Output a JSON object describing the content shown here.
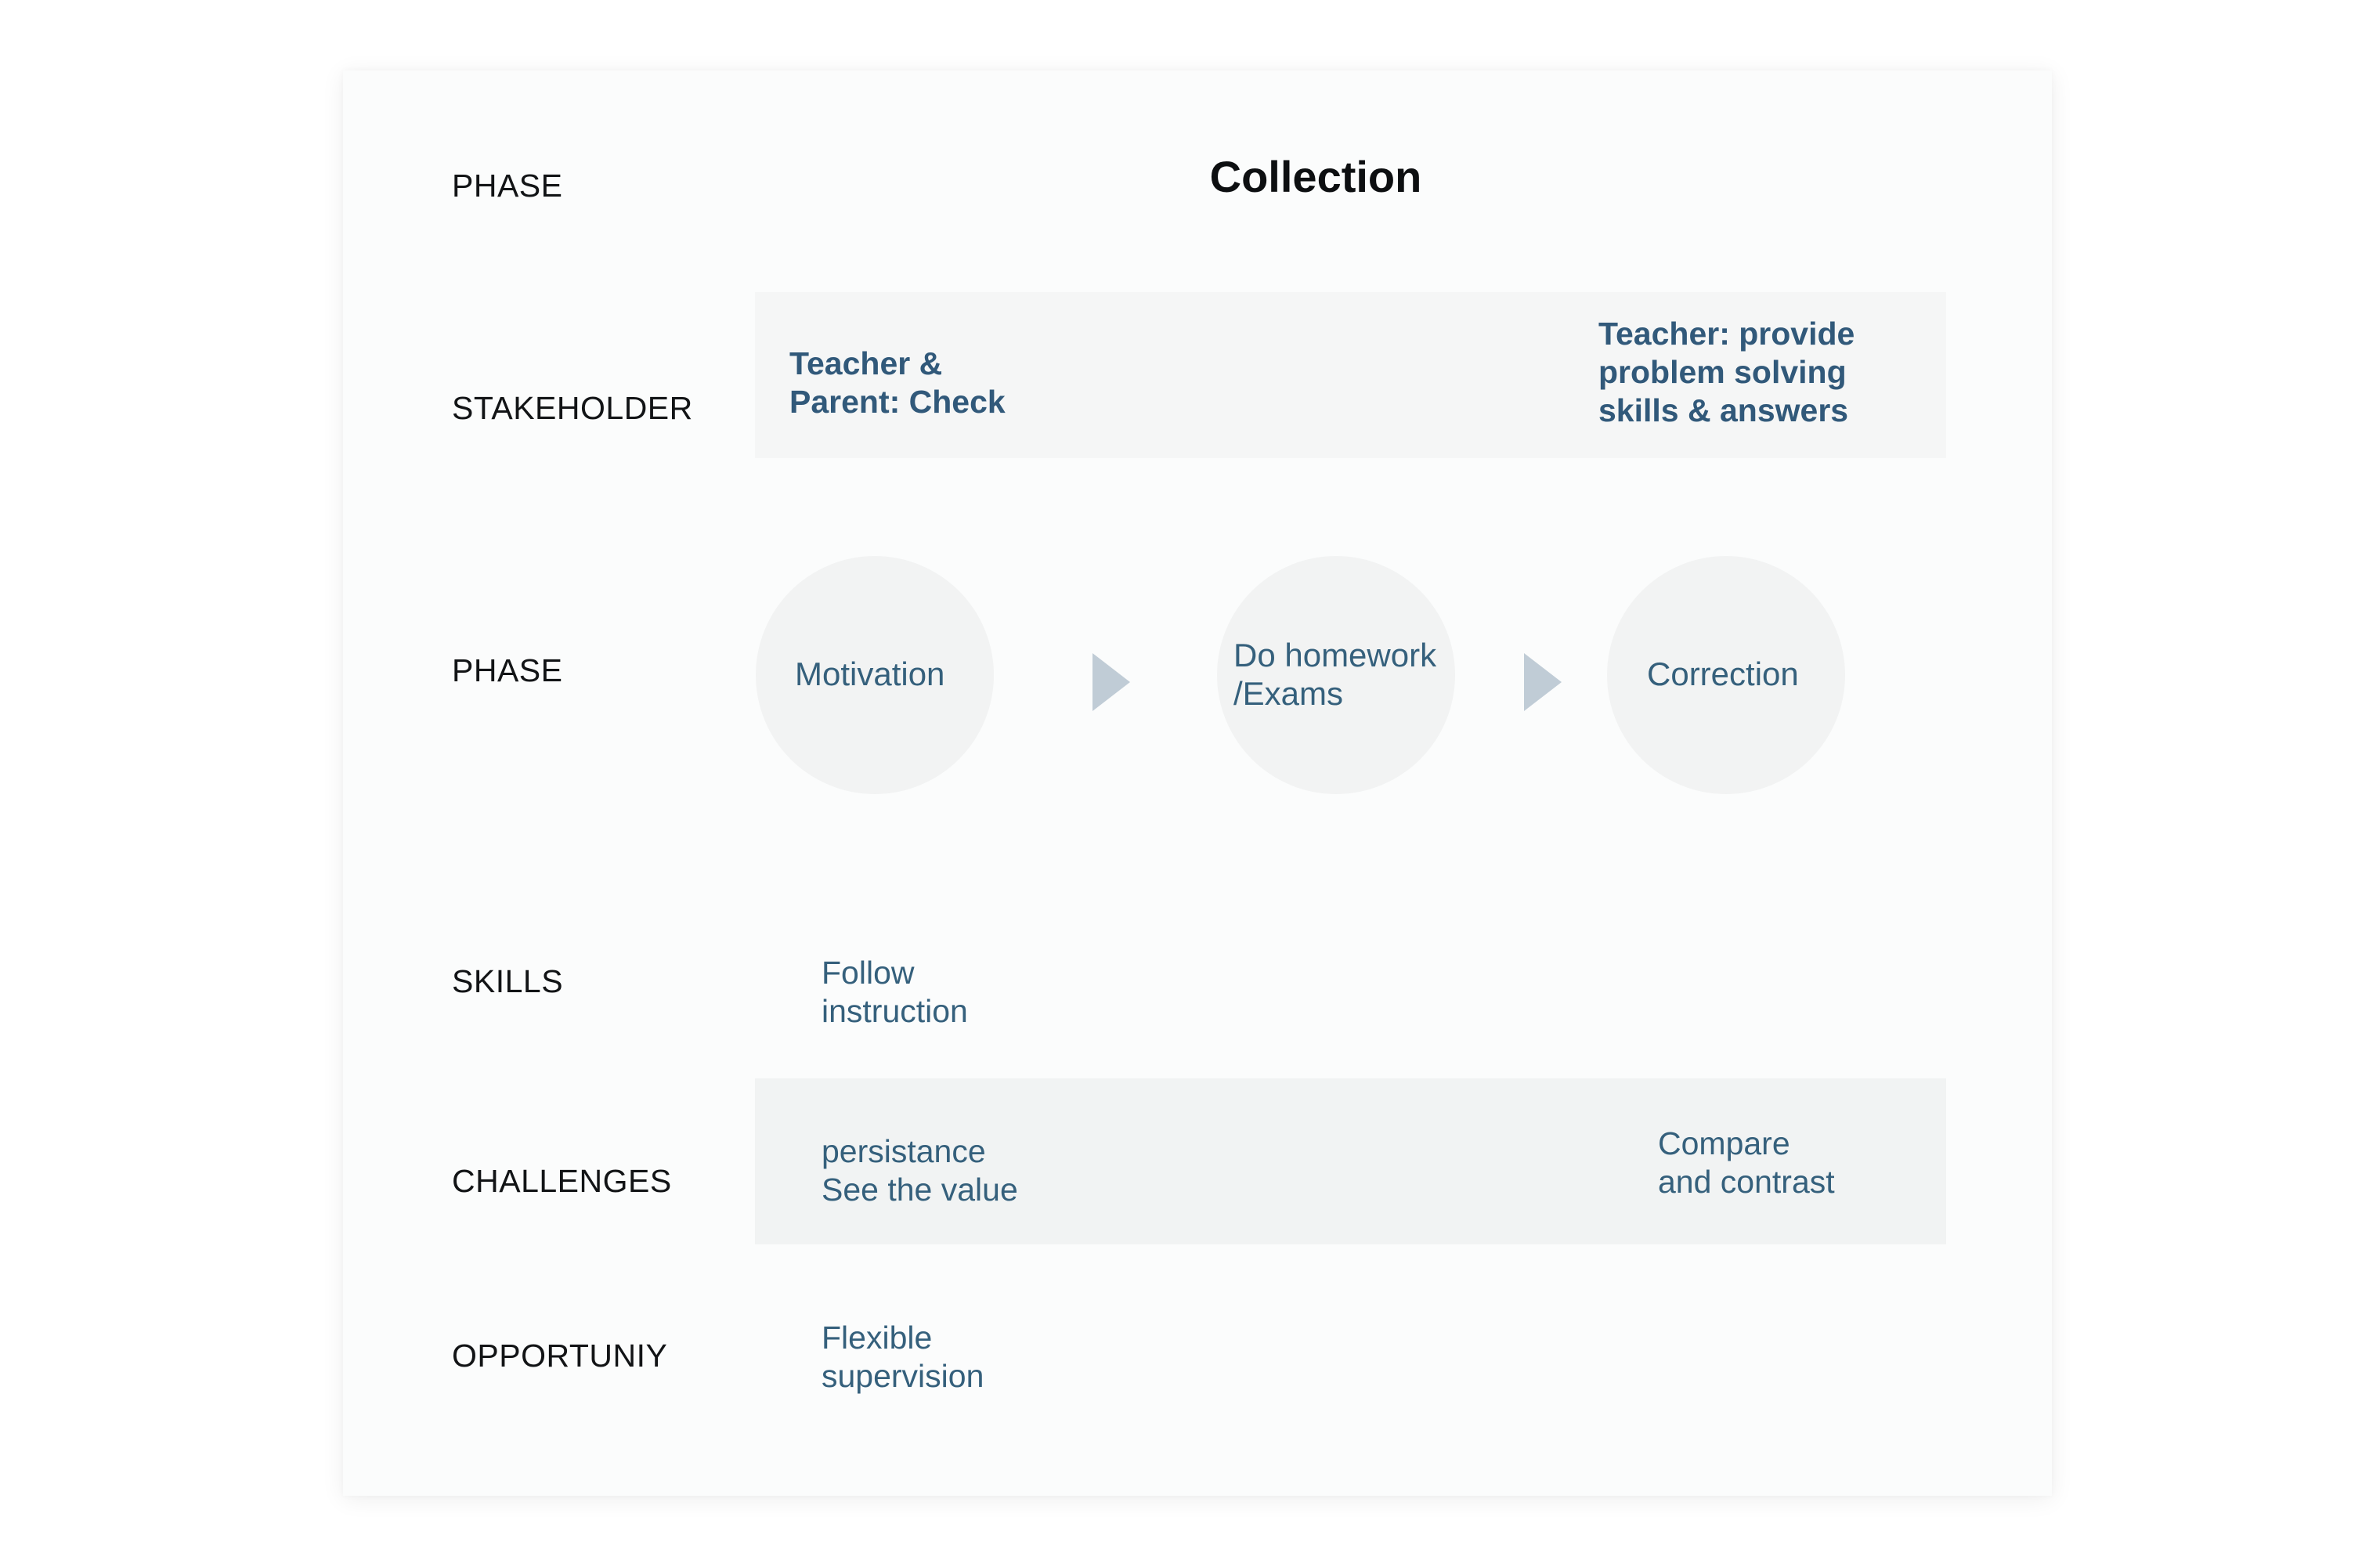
{
  "phase_header": {
    "label": "PHASE",
    "title": "Collection"
  },
  "stakeholder": {
    "label": "STAKEHOLDER",
    "left_text": "Teacher &\nParent: Check",
    "right_text": "Teacher: provide\nproblem solving\nskills & answers"
  },
  "phases": {
    "label": "PHASE",
    "steps": [
      {
        "label": "Motivation"
      },
      {
        "label": "Do homework\n/Exams"
      },
      {
        "label": "Correction"
      }
    ]
  },
  "skills": {
    "label": "SKILLS",
    "text": "Follow\ninstruction"
  },
  "challenges": {
    "label": "CHALLENGES",
    "left_text": "persistance\nSee the value",
    "right_text": "Compare\nand contrast"
  },
  "opportunity": {
    "label": "OPPORTUNIY",
    "text": "Flexible\nsupervision"
  },
  "colors": {
    "text_accent": "#35607c",
    "circle_fill": "#f2f3f3",
    "arrow_fill": "#c0ccd6",
    "band_fill": "#f5f6f6"
  }
}
